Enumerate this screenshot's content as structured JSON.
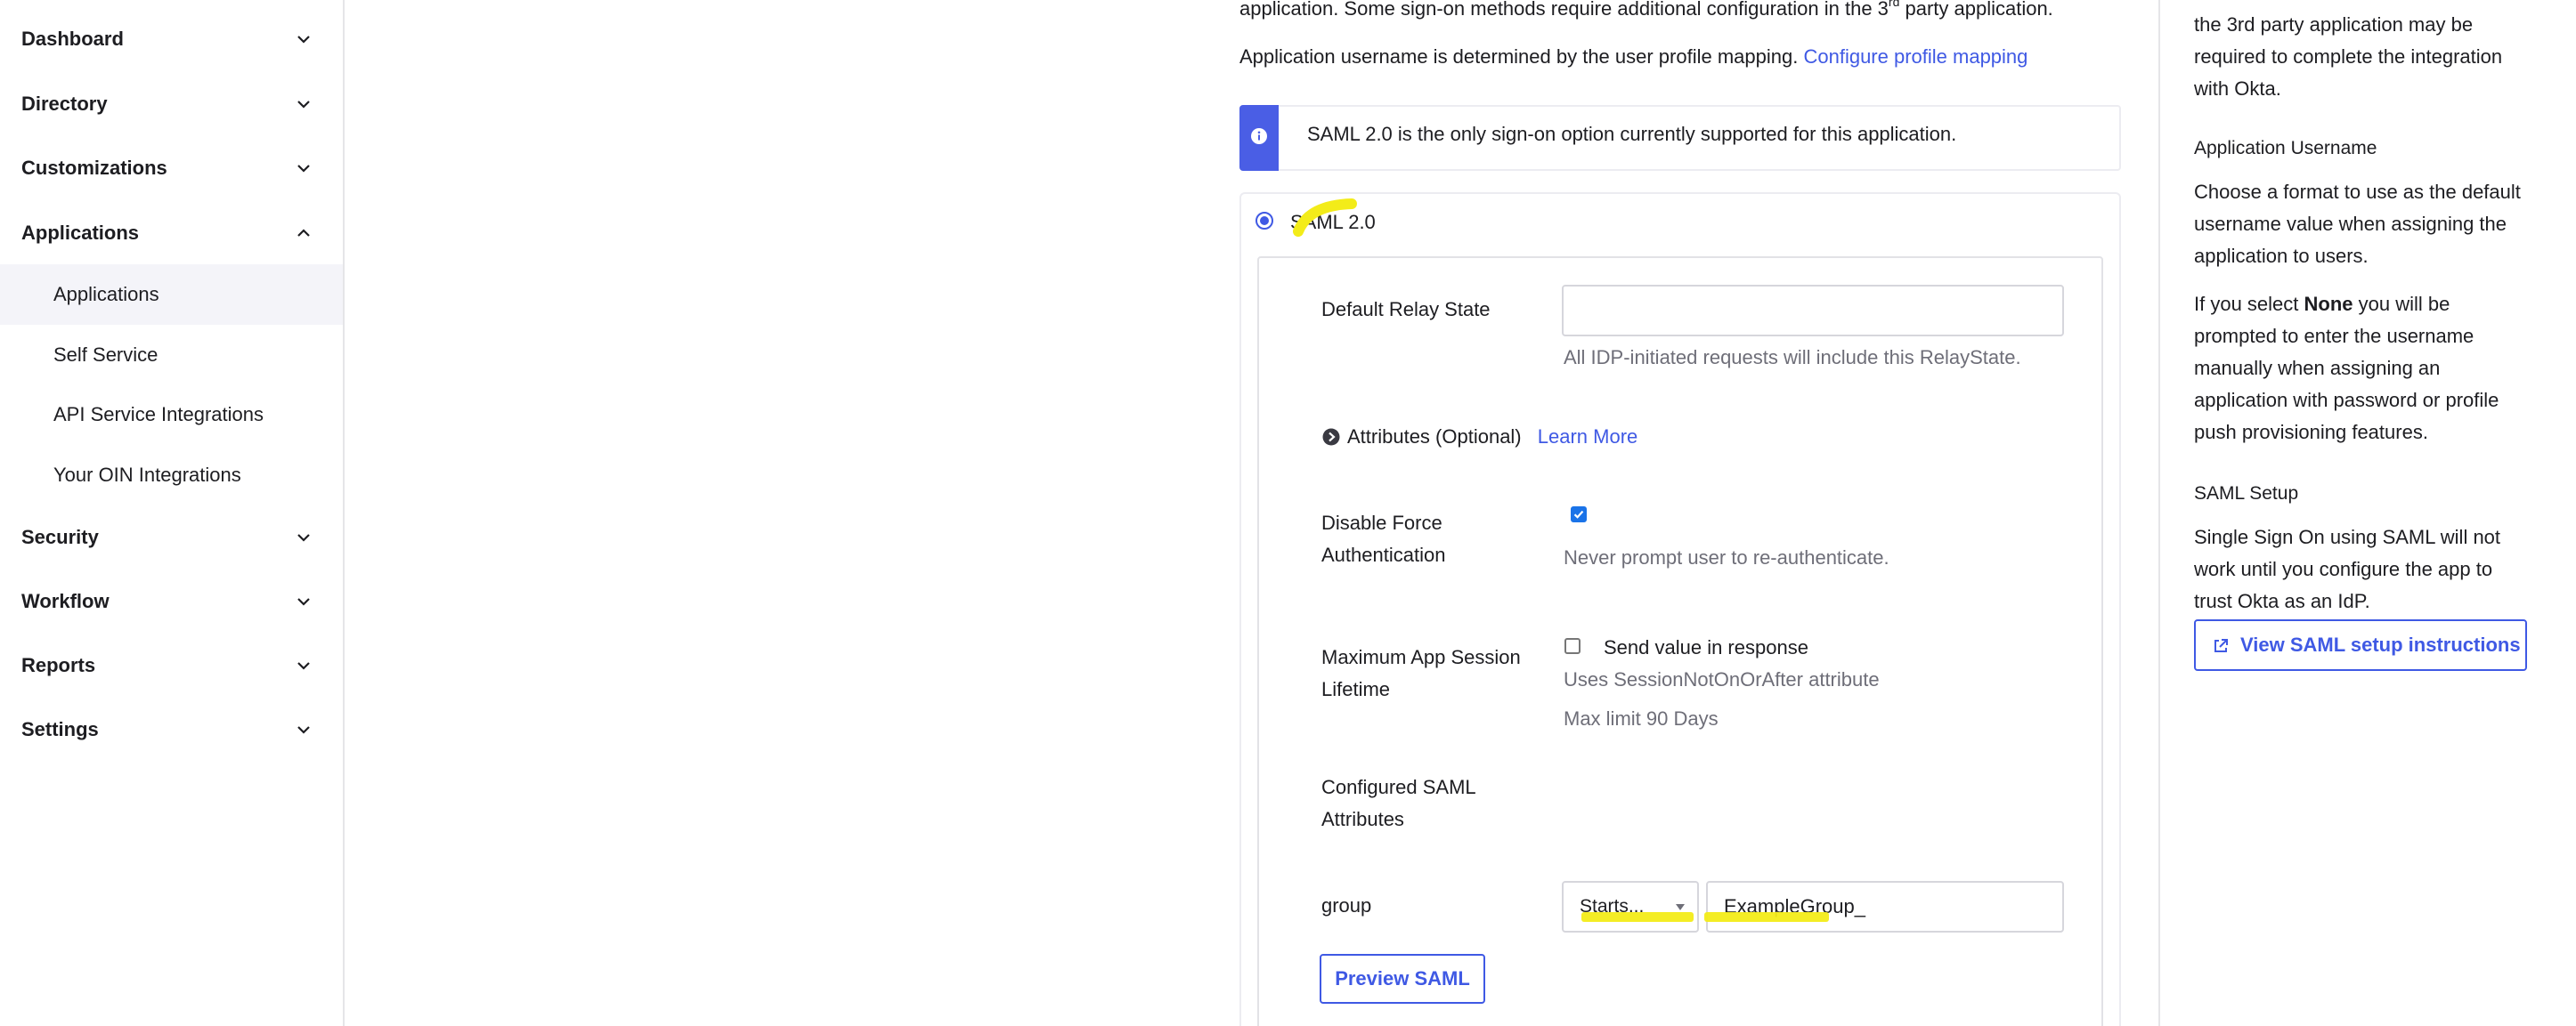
{
  "sidebar": {
    "sections": [
      {
        "label": "Dashboard",
        "expanded": false
      },
      {
        "label": "Directory",
        "expanded": false
      },
      {
        "label": "Customizations",
        "expanded": false
      },
      {
        "label": "Applications",
        "expanded": true
      },
      {
        "label": "Security",
        "expanded": false
      },
      {
        "label": "Workflow",
        "expanded": false
      },
      {
        "label": "Reports",
        "expanded": false
      },
      {
        "label": "Settings",
        "expanded": false
      }
    ],
    "applications_items": [
      "Applications",
      "Self Service",
      "API Service Integrations",
      "Your OIN Integrations"
    ],
    "active_item": "Applications"
  },
  "main": {
    "intro_line_pre": "application. Some sign-on methods require additional configuration in the 3",
    "intro_sup": "rd",
    "intro_line_post": " party application.",
    "username_line": "Application username is determined by the user profile mapping.",
    "username_link": "Configure profile mapping",
    "info_message": "SAML 2.0 is the only sign-on option currently supported for this application.",
    "saml_option_label": "SAML 2.0",
    "default_relay_state": {
      "label": "Default Relay State",
      "value": "",
      "help": "All IDP-initiated requests will include this RelayState."
    },
    "attributes": {
      "label": "Attributes (Optional)",
      "link": "Learn More"
    },
    "disable_force_auth": {
      "label_line1": "Disable Force",
      "label_line2": "Authentication",
      "checked": true,
      "help": "Never prompt user to re-authenticate."
    },
    "max_session": {
      "label_line1": "Maximum App Session",
      "label_line2": "Lifetime",
      "checked": false,
      "checkbox_label": "Send value in response",
      "help1": "Uses SessionNotOnOrAfter attribute",
      "help2": "Max limit 90 Days"
    },
    "configured_attrs": {
      "label_line1": "Configured SAML",
      "label_line2": "Attributes"
    },
    "group_attr": {
      "name": "group",
      "filter": "Starts...",
      "value": "ExampleGroup_"
    },
    "preview_button": "Preview SAML"
  },
  "right_panel": {
    "lines_top": [
      "the 3rd party application may be",
      "required to complete the integration",
      "with Okta."
    ],
    "app_username_heading": "Application Username",
    "app_username_lines": [
      "Choose a format to use as the default",
      "username value when assigning the",
      "application to users."
    ],
    "if_select_pre": "If you select ",
    "if_select_bold": "None",
    "if_select_post": " you will be",
    "none_lines": [
      "prompted to enter the username",
      "manually when assigning an",
      "application with password or profile",
      "push provisioning features."
    ],
    "saml_setup_heading": "SAML Setup",
    "saml_setup_lines": [
      "Single Sign On using SAML will not",
      "work until you configure the app to",
      "trust Okta as an IdP."
    ],
    "view_instructions_button": "View SAML setup instructions"
  },
  "colors": {
    "accent": "#3f59e4",
    "highlight": "#f3ec19",
    "info_bar": "#4a5ee5"
  }
}
